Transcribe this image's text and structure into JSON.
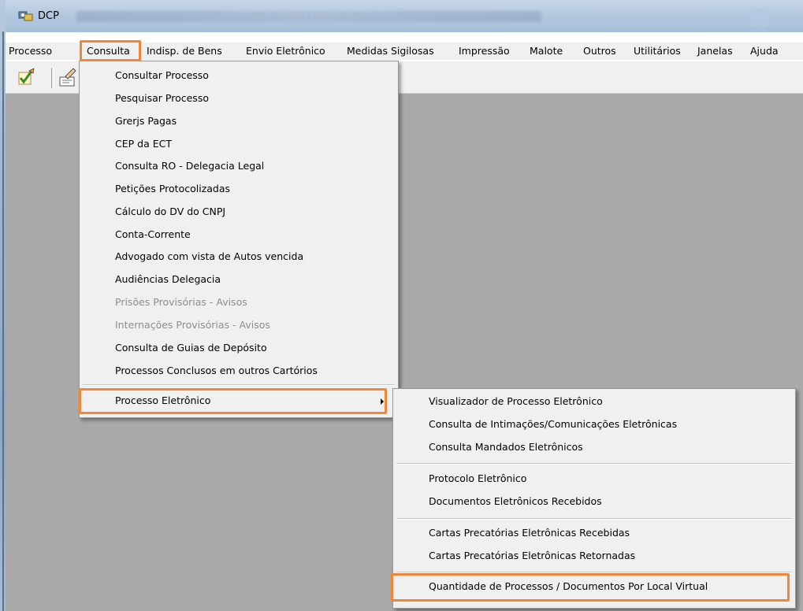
{
  "window": {
    "title": "DCP"
  },
  "menubar": {
    "items": [
      "Processo",
      "Consulta",
      "Indisp. de Bens",
      "Envio Eletrônico",
      "Medidas Sigilosas",
      "Impressão",
      "Malote",
      "Outros",
      "Utilitários",
      "Janelas",
      "Ajuda"
    ]
  },
  "consulta_menu": {
    "items": [
      {
        "label": "Consultar Processo",
        "enabled": true
      },
      {
        "label": "Pesquisar Processo",
        "enabled": true
      },
      {
        "label": "Grerjs Pagas",
        "enabled": true
      },
      {
        "label": "CEP da ECT",
        "enabled": true
      },
      {
        "label": "Consulta RO - Delegacia Legal",
        "enabled": true
      },
      {
        "label": "Petições Protocolizadas",
        "enabled": true
      },
      {
        "label": "Cálculo do DV do CNPJ",
        "enabled": true
      },
      {
        "label": "Conta-Corrente",
        "enabled": true
      },
      {
        "label": "Advogado com vista de Autos vencida",
        "enabled": true
      },
      {
        "label": "Audiências Delegacia",
        "enabled": true
      },
      {
        "label": "Prisões Provisórias - Avisos",
        "enabled": false
      },
      {
        "label": "Internações Provisórias - Avisos",
        "enabled": false
      },
      {
        "label": "Consulta de Guias de Depósito",
        "enabled": true
      },
      {
        "label": "Processos Conclusos em outros Cartórios",
        "enabled": true
      },
      {
        "label": "Processo Eletrônico",
        "enabled": true
      }
    ]
  },
  "processo_eletronico_menu": {
    "items": [
      {
        "label": "Visualizador de Processo Eletrônico"
      },
      {
        "label": "Consulta de Intimações/Comunicações Eletrônicas"
      },
      {
        "label": "Consulta Mandados Eletrônicos"
      },
      {
        "label": "Protocolo Eletrônico"
      },
      {
        "label": "Documentos Eletrônicos Recebidos"
      },
      {
        "label": "Cartas Precatórias Eletrônicas Recebidas"
      },
      {
        "label": "Cartas Precatórias Eletrônicas Retornadas"
      },
      {
        "label": "Quantidade de Processos / Documentos Por Local Virtual"
      }
    ]
  },
  "colors": {
    "highlight": "#f0863a",
    "workspace": "#a9a9a9",
    "menu_bg": "#f0f0f0",
    "disabled_text": "#8d8d8d"
  },
  "icons": {
    "app": "dcp-app-icon",
    "toolbar": [
      "checkmark-pencil-icon",
      "hand-writing-icon"
    ],
    "submenu": "submenu-arrow-icon"
  }
}
